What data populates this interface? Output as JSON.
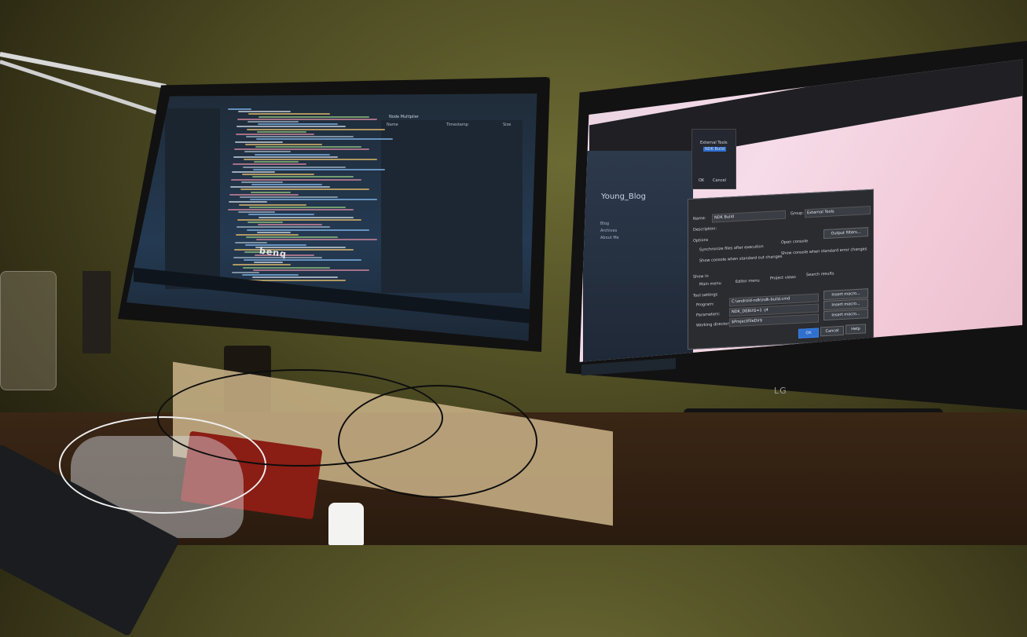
{
  "left_monitor": {
    "brand": "benq",
    "ide": {
      "title_bar": "",
      "right_panel_title": "Node Multiplier",
      "columns": [
        "Name",
        "Timestamp",
        "Size"
      ]
    }
  },
  "right_monitor": {
    "brand": "LG",
    "blog": {
      "title": "Young_Blog",
      "links": [
        "Blog",
        "Archives",
        "About Me"
      ]
    },
    "dialog": {
      "name_label": "Name:",
      "name_value": "NDK Build",
      "group_label": "Group:",
      "group_value": "External Tools",
      "description_label": "Description:",
      "options_label": "Options",
      "sync_files": "Synchronize files after execution",
      "open_console": "Open console",
      "show_console_stdout": "Show console when standard out changes",
      "show_console_stderr": "Show console when standard error changes",
      "show_in_label": "Show in",
      "main_menu": "Main menu",
      "editor_menu": "Editor menu",
      "project_views": "Project views",
      "search_results": "Search results",
      "tool_settings": "Tool settings",
      "program_label": "Program:",
      "program_value": "C:\\android-ndk\\ndk-build.cmd",
      "parameters_label": "Parameters:",
      "parameters_value": "NDK_DEBUG=1 -j4",
      "working_dir_label": "Working directory:",
      "working_dir_value": "$ProjectFileDir$",
      "insert_macro": "Insert macro...",
      "output_filters": "Output filters...",
      "ok": "OK",
      "cancel": "Cancel",
      "help": "Help"
    },
    "mini_dialog": {
      "item1": "External Tools",
      "item2": "NDK Build",
      "ok": "OK",
      "cancel": "Cancel"
    }
  },
  "colors": {
    "wall": "#5a5a2a",
    "ide_bg": "#243a52",
    "blog_bg": "#f2d3e2",
    "dialog_bg": "#2a2c30",
    "ok_blue": "#2f6fcf"
  }
}
